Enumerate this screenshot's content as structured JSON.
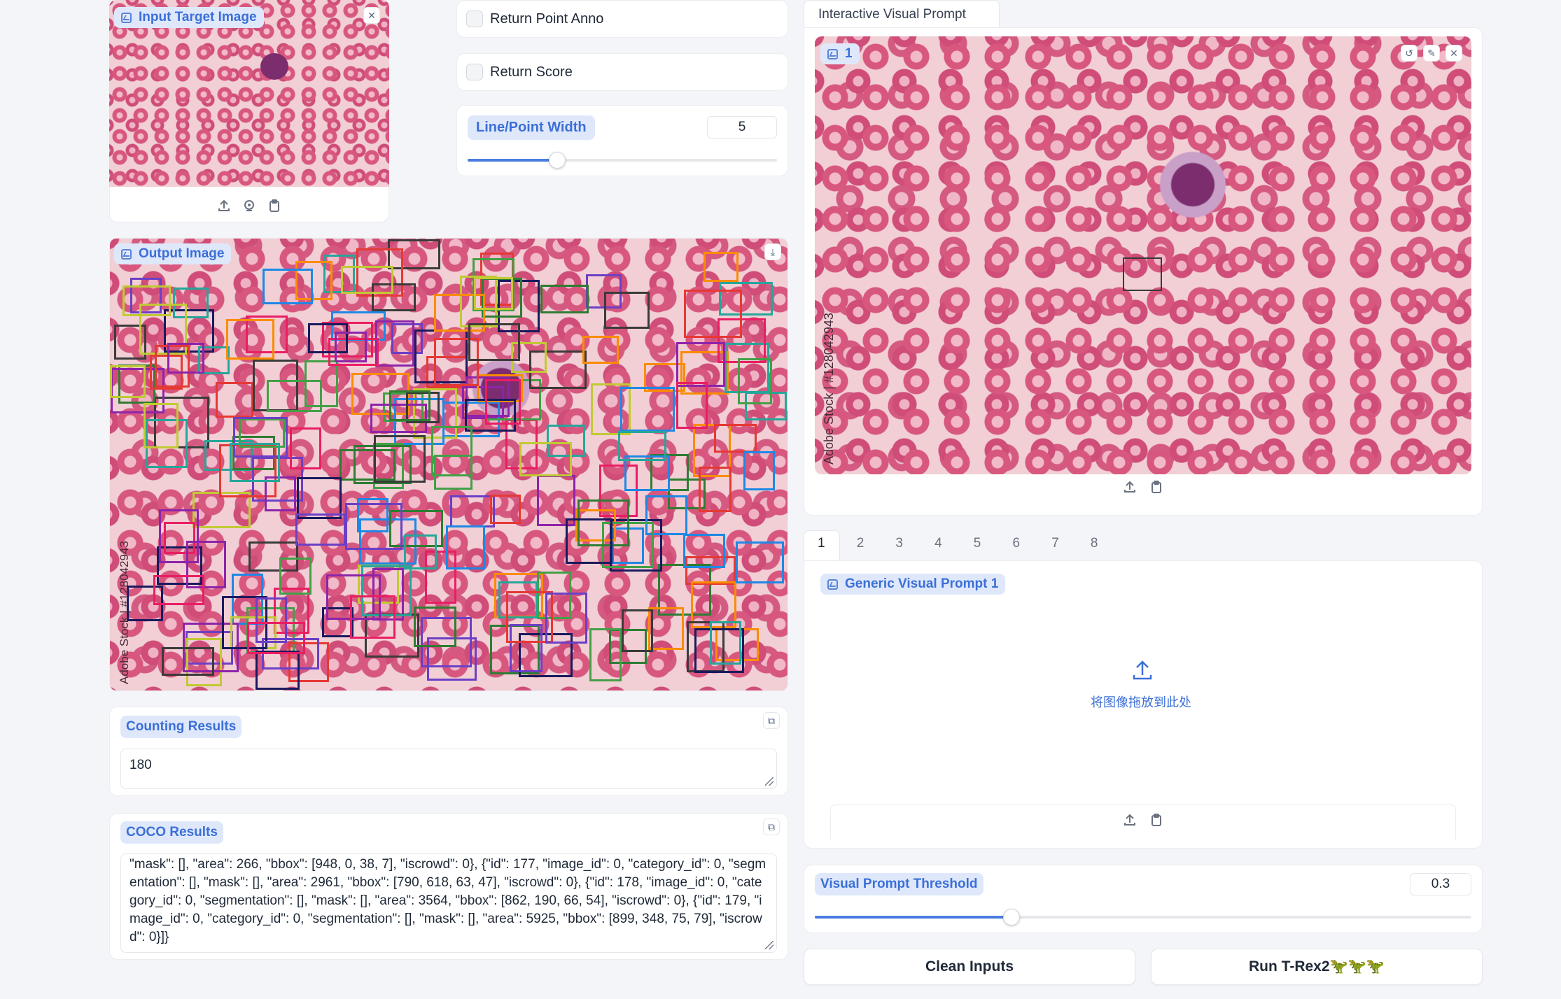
{
  "input_image": {
    "label": "Input Target Image"
  },
  "options": {
    "return_point_anno": "Return Point Anno",
    "return_score": "Return Score"
  },
  "line_width": {
    "label": "Line/Point Width",
    "value": "5",
    "fraction": 0.29
  },
  "output_image": {
    "label": "Output Image",
    "watermark": "Adobe Stock | #128042943",
    "box_colors": [
      "#3b3b3b",
      "#2e7d32",
      "#6c3fc5",
      "#e53935",
      "#43a047",
      "#1e88e5",
      "#8e24aa",
      "#1a1a5e",
      "#26a69a",
      "#fb8c00",
      "#c0ca33",
      "#e91e63"
    ]
  },
  "counting": {
    "label": "Counting Results",
    "value": "180"
  },
  "coco": {
    "label": "COCO Results",
    "value": "\"mask\": [], \"area\": 266, \"bbox\": [948, 0, 38, 7], \"iscrowd\": 0}, {\"id\": 177, \"image_id\": 0, \"category_id\": 0, \"segmentation\": [], \"mask\": [], \"area\": 2961, \"bbox\": [790, 618, 63, 47], \"iscrowd\": 0}, {\"id\": 178, \"image_id\": 0, \"category_id\": 0, \"segmentation\": [], \"mask\": [], \"area\": 3564, \"bbox\": [862, 190, 66, 54], \"iscrowd\": 0}, {\"id\": 179, \"image_id\": 0, \"category_id\": 0, \"segmentation\": [], \"mask\": [], \"area\": 5925, \"bbox\": [899, 348, 75, 79], \"iscrowd\": 0}]}"
  },
  "interactive": {
    "tab": "Interactive Visual Prompt",
    "canvas_label": "1",
    "watermark": "Adobe Stock | #128042943"
  },
  "prompt_tabs": [
    "1",
    "2",
    "3",
    "4",
    "5",
    "6",
    "7",
    "8"
  ],
  "generic_prompt": {
    "label": "Generic Visual Prompt 1",
    "drop_text": "将图像拖放到此处"
  },
  "threshold": {
    "label": "Visual Prompt Threshold",
    "value": "0.3",
    "fraction": 0.3
  },
  "buttons": {
    "clean": "Clean Inputs",
    "run": "Run T-Rex2🦖🦖🦖"
  }
}
